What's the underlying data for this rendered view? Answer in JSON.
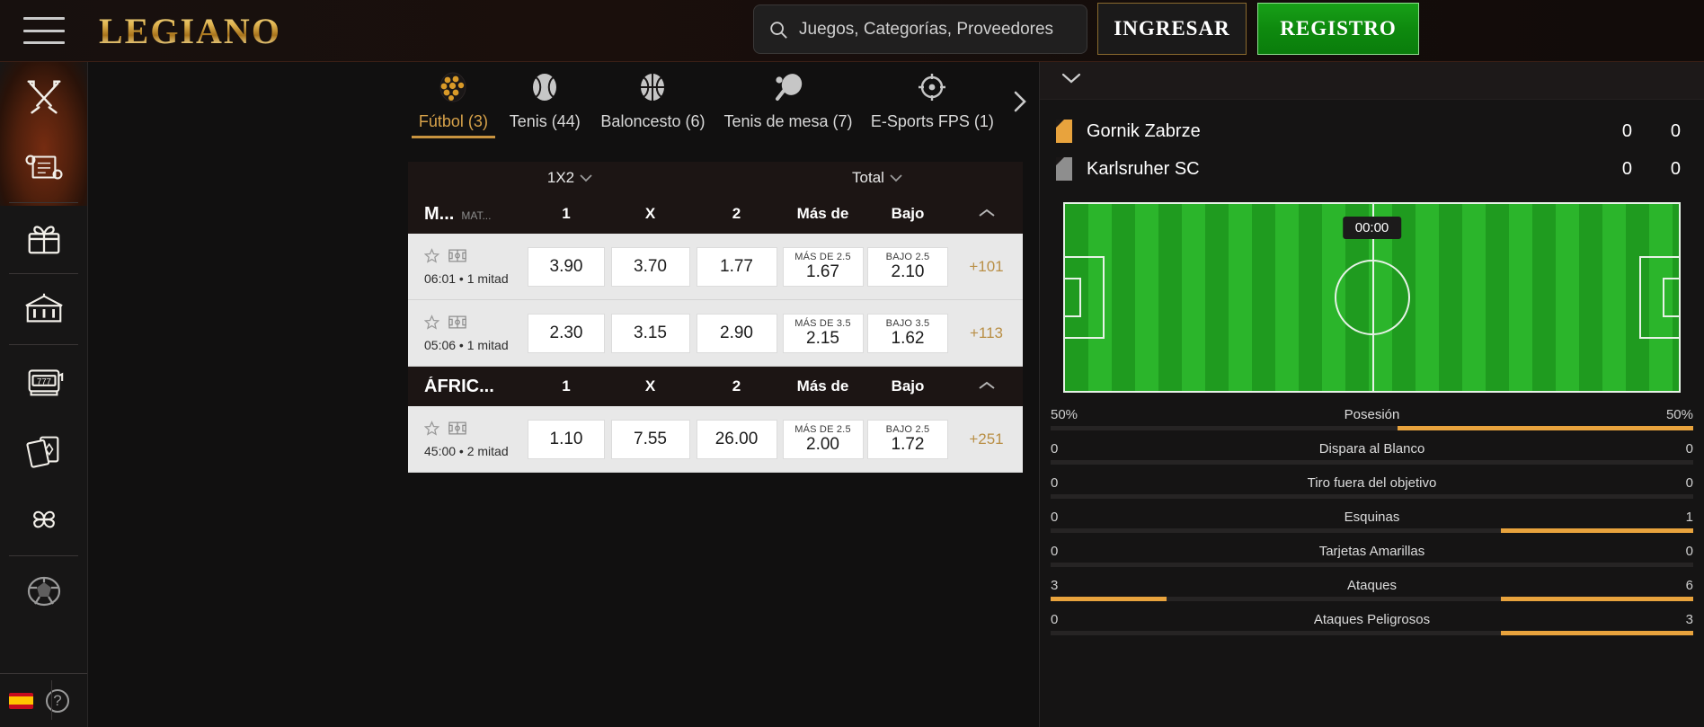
{
  "header": {
    "menu_icon": "hamburger-icon",
    "logo": "LEGIANO",
    "search": {
      "icon": "search-icon",
      "placeholder": "Juegos, Categorías, Proveedores",
      "value": ""
    },
    "login_label": "INGRESAR",
    "register_label": "REGISTRO",
    "colors": {
      "gold": "#d7a24a",
      "green": "#129012"
    }
  },
  "sidebar": {
    "items": [
      {
        "icon": "crossed-swords-icon",
        "name": "sidebar-item-battles"
      },
      {
        "icon": "scroll-icon",
        "name": "sidebar-item-quests"
      },
      {
        "icon": "gift-box-icon",
        "name": "sidebar-item-bonuses"
      },
      {
        "icon": "casino-building-icon",
        "name": "sidebar-item-casino"
      },
      {
        "icon": "slot-machine-icon",
        "name": "sidebar-item-slots"
      },
      {
        "icon": "playing-cards-icon",
        "name": "sidebar-item-table-games"
      },
      {
        "icon": "four-leaf-clover-icon",
        "name": "sidebar-item-lucky"
      },
      {
        "icon": "football-icon",
        "name": "sidebar-item-sports"
      }
    ],
    "language_flag": "spain-flag-icon",
    "help_label": "?"
  },
  "sports_tabs": {
    "next_icon": "chevron-right-icon",
    "items": [
      {
        "label": "Fútbol (3)",
        "icon": "football-icon",
        "active": true
      },
      {
        "label": "Tenis (44)",
        "icon": "tennis-ball-icon",
        "active": false
      },
      {
        "label": "Baloncesto (6)",
        "icon": "basketball-icon",
        "active": false
      },
      {
        "label": "Tenis de mesa (7)",
        "icon": "table-tennis-icon",
        "active": false
      },
      {
        "label": "E-Sports FPS (1)",
        "icon": "crosshair-icon",
        "active": false
      }
    ]
  },
  "market_bar": {
    "market_1x2": "1X2",
    "market_total": "Total",
    "chevron_icon": "chevron-down-icon"
  },
  "board": {
    "groups": [
      {
        "name": "M...",
        "match_label": "MAT...",
        "collapse_icon": "chevron-up-icon",
        "columns": [
          "1",
          "X",
          "2",
          "Más de",
          "Bajo"
        ],
        "rows": [
          {
            "favorite_icon": "star-icon",
            "pitch_icon": "field-stats-icon",
            "time": "06:01 • 1 mitad",
            "odd_1": "3.90",
            "odd_x": "3.70",
            "odd_2": "1.77",
            "over_label": "MÁS DE 2.5",
            "over_value": "1.67",
            "under_label": "BAJO 2.5",
            "under_value": "2.10",
            "more": "+101"
          },
          {
            "favorite_icon": "star-icon",
            "pitch_icon": "field-stats-icon",
            "time": "05:06 • 1 mitad",
            "odd_1": "2.30",
            "odd_x": "3.15",
            "odd_2": "2.90",
            "over_label": "MÁS DE 3.5",
            "over_value": "2.15",
            "under_label": "BAJO 3.5",
            "under_value": "1.62",
            "more": "+113"
          }
        ]
      },
      {
        "name": "ÁFRIC...",
        "match_label": "",
        "collapse_icon": "chevron-up-icon",
        "columns": [
          "1",
          "X",
          "2",
          "Más de",
          "Bajo"
        ],
        "rows": [
          {
            "favorite_icon": "star-icon",
            "pitch_icon": "field-stats-icon",
            "time": "45:00 • 2 mitad",
            "odd_1": "1.10",
            "odd_x": "7.55",
            "odd_2": "26.00",
            "over_label": "MÁS DE 2.5",
            "over_value": "2.00",
            "under_label": "BAJO 2.5",
            "under_value": "1.72",
            "more": "+251"
          }
        ]
      }
    ]
  },
  "right_panel": {
    "collapse_icon": "chevron-down-icon",
    "match": {
      "home": {
        "name": "Gornik Zabrze",
        "badge": "team-badge-home",
        "score_a": "0",
        "score_b": "0"
      },
      "away": {
        "name": "Karlsruher SC",
        "badge": "team-badge-away",
        "score_a": "0",
        "score_b": "0"
      }
    },
    "pitch": {
      "timer": "00:00"
    },
    "stats": [
      {
        "label": "Posesión",
        "home": "50%",
        "away": "50%",
        "home_pct": 50,
        "away_pct": 50
      },
      {
        "label": "Dispara al Blanco",
        "home": "0",
        "away": "0",
        "home_pct": 0,
        "away_pct": 0
      },
      {
        "label": "Tiro fuera del objetivo",
        "home": "0",
        "away": "0",
        "home_pct": 0,
        "away_pct": 0
      },
      {
        "label": "Esquinas",
        "home": "0",
        "away": "1",
        "home_pct": 0,
        "away_pct": 100
      },
      {
        "label": "Tarjetas Amarillas",
        "home": "0",
        "away": "0",
        "home_pct": 0,
        "away_pct": 0
      },
      {
        "label": "Ataques",
        "home": "3",
        "away": "6",
        "home_pct": 33,
        "away_pct": 67
      },
      {
        "label": "Ataques Peligrosos",
        "home": "0",
        "away": "3",
        "home_pct": 0,
        "away_pct": 100
      }
    ]
  }
}
